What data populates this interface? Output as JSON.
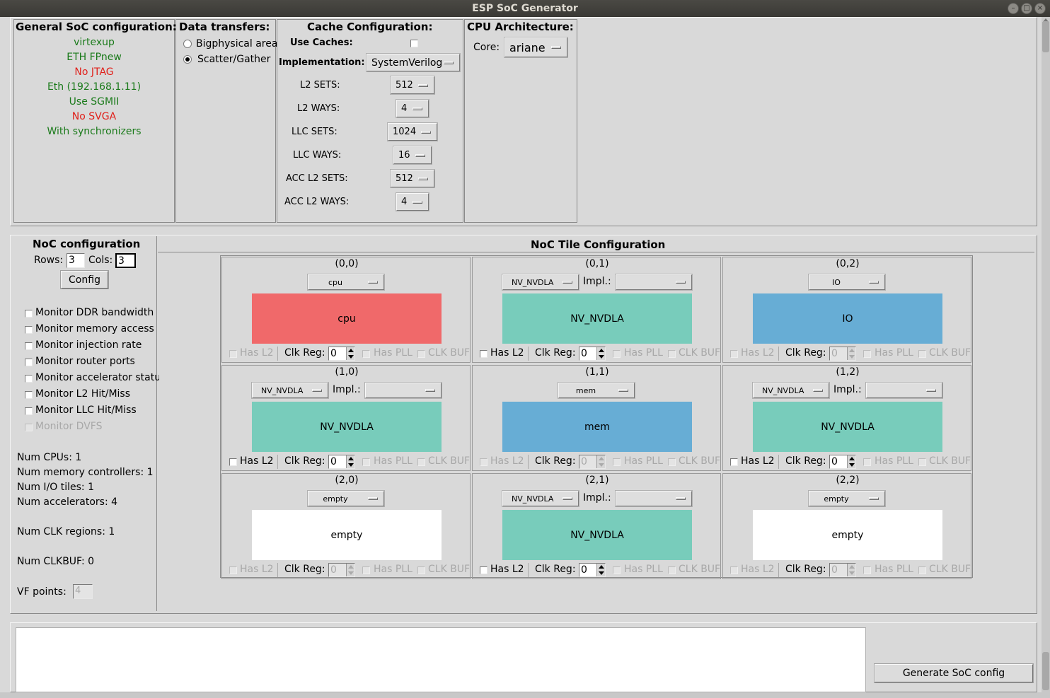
{
  "window": {
    "title": "ESP SoC Generator"
  },
  "general": {
    "header": "General SoC configuration:",
    "items": [
      {
        "text": "virtexup",
        "color": "green"
      },
      {
        "text": "ETH FPnew",
        "color": "green"
      },
      {
        "text": "No JTAG",
        "color": "red"
      },
      {
        "text": "Eth (192.168.1.11)",
        "color": "green"
      },
      {
        "text": "Use SGMII",
        "color": "green"
      },
      {
        "text": "No SVGA",
        "color": "red"
      },
      {
        "text": "With synchronizers",
        "color": "green"
      }
    ]
  },
  "transfers": {
    "header": "Data transfers:",
    "options": [
      {
        "label": "Bigphysical area",
        "selected": false
      },
      {
        "label": "Scatter/Gather",
        "selected": true
      }
    ]
  },
  "cache": {
    "header": "Cache Configuration:",
    "use_caches_label": "Use Caches:",
    "implementation_label": "Implementation:",
    "implementation_value": "SystemVerilog",
    "rows": [
      {
        "label": "L2 SETS:",
        "value": "512"
      },
      {
        "label": "L2 WAYS:",
        "value": "4"
      },
      {
        "label": "LLC SETS:",
        "value": "1024"
      },
      {
        "label": "LLC WAYS:",
        "value": "16"
      },
      {
        "label": "ACC L2 SETS:",
        "value": "512"
      },
      {
        "label": "ACC L2 WAYS:",
        "value": "4"
      }
    ]
  },
  "cpu": {
    "header": "CPU Architecture:",
    "core_label": "Core:",
    "core_value": "ariane"
  },
  "noc": {
    "header": "NoC configuration",
    "rows_label": "Rows:",
    "rows_value": "3",
    "cols_label": "Cols:",
    "cols_value": "3",
    "config_button": "Config",
    "monitors": [
      {
        "label": "Monitor DDR bandwidth",
        "disabled": false
      },
      {
        "label": "Monitor memory access",
        "disabled": false
      },
      {
        "label": "Monitor injection rate",
        "disabled": false
      },
      {
        "label": "Monitor router ports",
        "disabled": false
      },
      {
        "label": "Monitor accelerator statu",
        "disabled": false
      },
      {
        "label": "Monitor L2 Hit/Miss",
        "disabled": false
      },
      {
        "label": "Monitor LLC Hit/Miss",
        "disabled": false
      },
      {
        "label": "Monitor DVFS",
        "disabled": true
      }
    ],
    "stats": {
      "cpus": "Num CPUs: 1",
      "mem": "Num memory controllers: 1",
      "io": "Num I/O tiles: 1",
      "acc": "Num accelerators: 4",
      "clk": "Num CLK regions: 1",
      "clkbuf": "Num CLKBUF: 0",
      "vf_label": "VF points:",
      "vf_value": "4"
    }
  },
  "tiles": {
    "header": "NoC Tile Configuration",
    "has_l2": "Has L2",
    "clk_reg": "Clk Reg:",
    "has_pll": "Has PLL",
    "clk_buf": "CLK BUF",
    "impl": "Impl.:",
    "colors": {
      "cpu": "#f0696a",
      "acc": "#78ccbb",
      "blue": "#67add5",
      "empty": "#ffffff"
    },
    "grid": [
      {
        "coord": "(0,0)",
        "type": "cpu",
        "label": "cpu",
        "color": "cpu",
        "impl": false,
        "l2_enabled": false,
        "clk_enabled": true,
        "clk": "0"
      },
      {
        "coord": "(0,1)",
        "type": "NV_NVDLA",
        "label": "NV_NVDLA",
        "color": "acc",
        "impl": true,
        "l2_enabled": true,
        "clk_enabled": true,
        "clk": "0"
      },
      {
        "coord": "(0,2)",
        "type": "IO",
        "label": "IO",
        "color": "blue",
        "impl": false,
        "l2_enabled": false,
        "clk_enabled": false,
        "clk": "0"
      },
      {
        "coord": "(1,0)",
        "type": "NV_NVDLA",
        "label": "NV_NVDLA",
        "color": "acc",
        "impl": true,
        "l2_enabled": true,
        "clk_enabled": true,
        "clk": "0"
      },
      {
        "coord": "(1,1)",
        "type": "mem",
        "label": "mem",
        "color": "blue",
        "impl": false,
        "l2_enabled": false,
        "clk_enabled": false,
        "clk": "0"
      },
      {
        "coord": "(1,2)",
        "type": "NV_NVDLA",
        "label": "NV_NVDLA",
        "color": "acc",
        "impl": true,
        "l2_enabled": true,
        "clk_enabled": true,
        "clk": "0"
      },
      {
        "coord": "(2,0)",
        "type": "empty",
        "label": "empty",
        "color": "empty",
        "impl": false,
        "l2_enabled": false,
        "clk_enabled": false,
        "clk": "0"
      },
      {
        "coord": "(2,1)",
        "type": "NV_NVDLA",
        "label": "NV_NVDLA",
        "color": "acc",
        "impl": true,
        "l2_enabled": true,
        "clk_enabled": true,
        "clk": "0"
      },
      {
        "coord": "(2,2)",
        "type": "empty",
        "label": "empty",
        "color": "empty",
        "impl": false,
        "l2_enabled": false,
        "clk_enabled": false,
        "clk": "0"
      }
    ]
  },
  "bottom": {
    "generate_button": "Generate SoC config"
  }
}
